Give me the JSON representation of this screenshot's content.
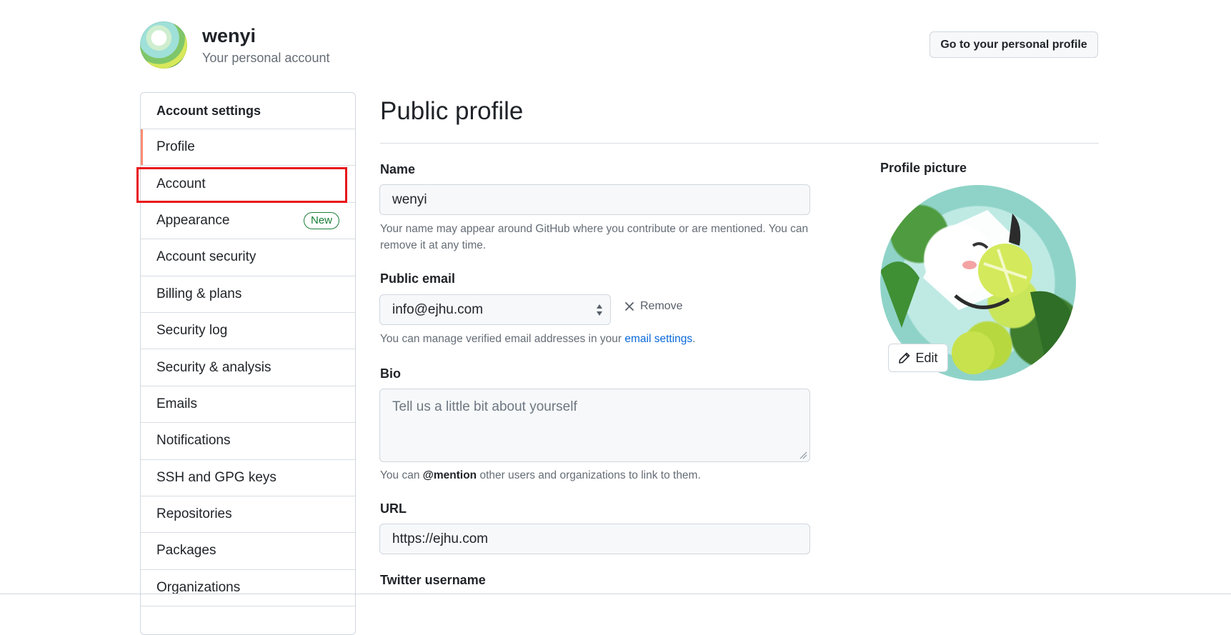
{
  "header": {
    "username": "wenyi",
    "subtitle": "Your personal account",
    "profile_button": "Go to your personal profile"
  },
  "sidebar": {
    "heading": "Account settings",
    "items": [
      {
        "label": "Profile",
        "selected": true
      },
      {
        "label": "Account",
        "highlighted": true
      },
      {
        "label": "Appearance",
        "badge": "New"
      },
      {
        "label": "Account security"
      },
      {
        "label": "Billing & plans"
      },
      {
        "label": "Security log"
      },
      {
        "label": "Security & analysis"
      },
      {
        "label": "Emails"
      },
      {
        "label": "Notifications"
      },
      {
        "label": "SSH and GPG keys"
      },
      {
        "label": "Repositories"
      },
      {
        "label": "Packages"
      },
      {
        "label": "Organizations"
      }
    ]
  },
  "main": {
    "title": "Public profile",
    "name": {
      "label": "Name",
      "value": "wenyi",
      "note": "Your name may appear around GitHub where you contribute or are mentioned. You can remove it at any time."
    },
    "public_email": {
      "label": "Public email",
      "selected": "info@ejhu.com",
      "remove_label": "Remove",
      "note_prefix": "You can manage verified email addresses in your ",
      "note_link": "email settings",
      "note_suffix": "."
    },
    "bio": {
      "label": "Bio",
      "placeholder": "Tell us a little bit about yourself",
      "note_prefix": "You can ",
      "note_mention": "@mention",
      "note_suffix": " other users and organizations to link to them."
    },
    "url": {
      "label": "URL",
      "value": "https://ejhu.com"
    },
    "twitter": {
      "label": "Twitter username"
    }
  },
  "profile_picture": {
    "label": "Profile picture",
    "edit_label": "Edit"
  },
  "colors": {
    "selected_indicator": "#fd8c73",
    "highlight_box": "#e8141b",
    "link": "#0969da",
    "badge_green": "#1a7f37"
  },
  "icons": {
    "remove": "close-icon",
    "edit": "pencil-icon",
    "select": "select-arrows-icon"
  }
}
